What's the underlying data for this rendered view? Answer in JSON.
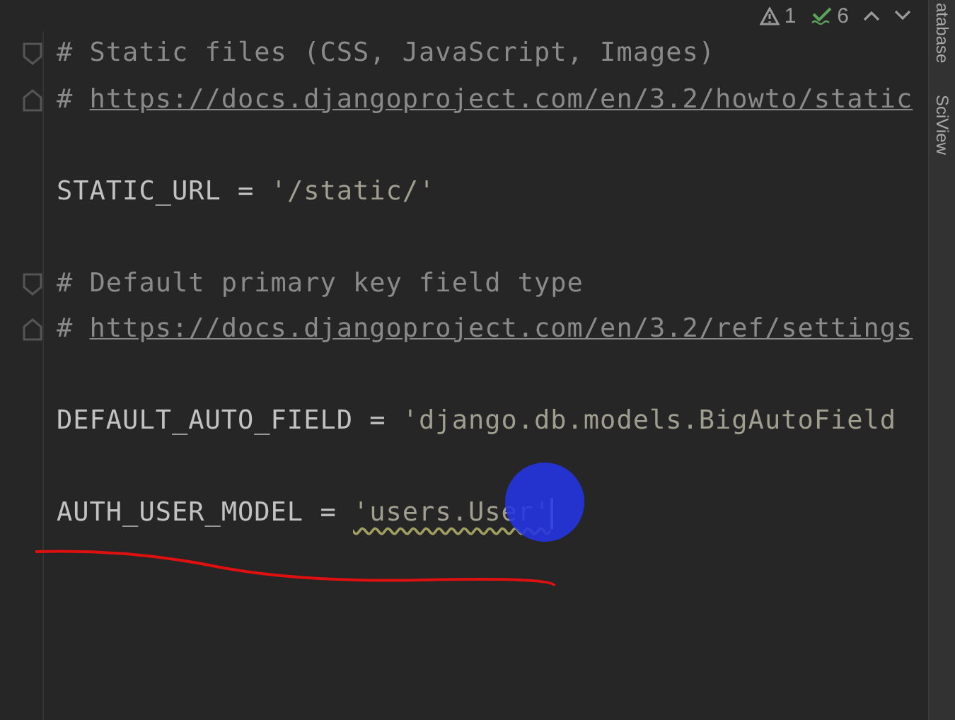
{
  "inspections": {
    "warnings": "1",
    "weak_warnings": "6"
  },
  "lines": [
    {
      "kind": "comment",
      "prefix": "#",
      "foldable": true,
      "text": "Static files (CSS, JavaScript, Images)"
    },
    {
      "kind": "link",
      "prefix": "#",
      "foldable": true,
      "text": "https://docs.djangoproject.com/en/3.2/howto/static"
    },
    {
      "kind": "blank"
    },
    {
      "kind": "assign",
      "name": "STATIC_URL",
      "operator": "=",
      "value": "'/static/'",
      "warning": false,
      "caret": false
    },
    {
      "kind": "blank"
    },
    {
      "kind": "comment",
      "prefix": "#",
      "foldable": true,
      "text": "Default primary key field type"
    },
    {
      "kind": "link",
      "prefix": "#",
      "foldable": true,
      "text": "https://docs.djangoproject.com/en/3.2/ref/settings"
    },
    {
      "kind": "blank"
    },
    {
      "kind": "assign",
      "name": "DEFAULT_AUTO_FIELD",
      "operator": "=",
      "value": "'django.db.models.BigAutoField",
      "warning": false,
      "caret": false
    },
    {
      "kind": "blank"
    },
    {
      "kind": "assign",
      "name": "AUTH_USER_MODEL",
      "operator": "=",
      "value": "'users.User'",
      "warning": true,
      "caret": true
    }
  ],
  "side_tabs": [
    "atabase",
    "SciView"
  ]
}
